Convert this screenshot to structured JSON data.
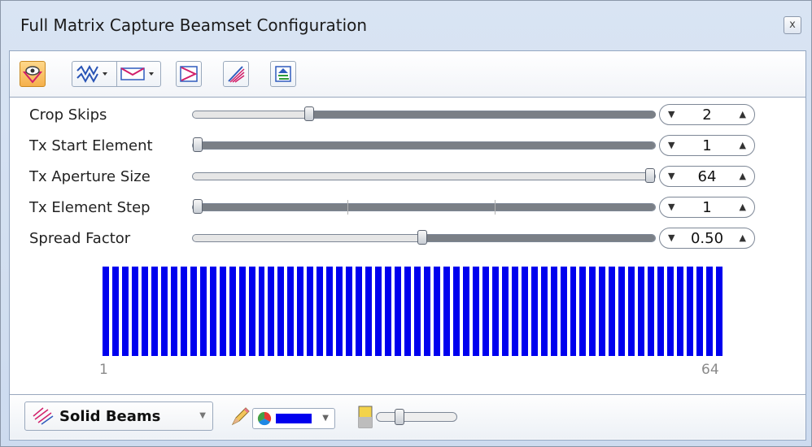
{
  "window": {
    "title": "Full Matrix Capture Beamset Configuration",
    "close_symbol": "x"
  },
  "toolbar": {
    "buttons": [
      {
        "name": "view-eye",
        "active": true
      },
      {
        "name": "waveform-dropdown"
      },
      {
        "name": "beam-shape-dropdown"
      },
      {
        "name": "reverse-beam"
      },
      {
        "name": "beam-fan"
      },
      {
        "name": "beam-plot"
      }
    ]
  },
  "settings": [
    {
      "label": "Crop Skips",
      "value": "2",
      "slider_fraction": 0.25
    },
    {
      "label": "Tx Start Element",
      "value": "1",
      "slider_fraction": 0.0
    },
    {
      "label": "Tx Aperture Size",
      "value": "64",
      "slider_fraction": 1.0
    },
    {
      "label": "Tx Element Step",
      "value": "1",
      "slider_fraction": 0.0
    },
    {
      "label": "Spread Factor",
      "value": "0.50",
      "slider_fraction": 0.5
    }
  ],
  "element_plot": {
    "count": 64,
    "axis_min": "1",
    "axis_max": "64",
    "bar_color": "#0000ee"
  },
  "bottom": {
    "render_mode": "Solid Beams",
    "color": "#0000ee",
    "opacity_fraction": 0.25
  }
}
